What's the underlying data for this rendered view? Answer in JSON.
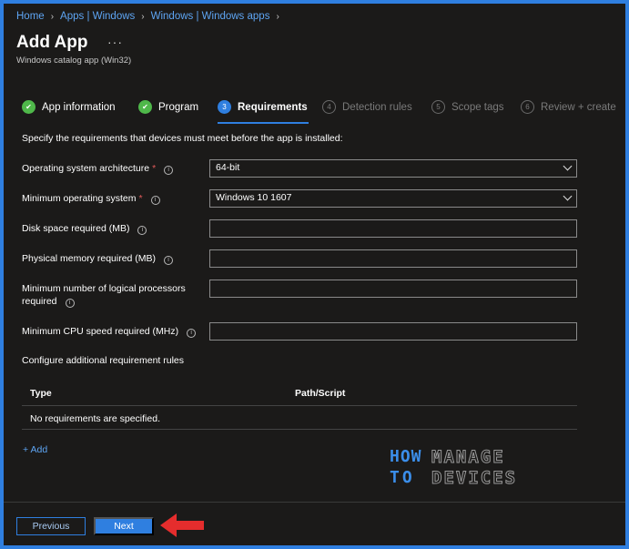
{
  "breadcrumb": [
    "Home",
    "Apps | Windows",
    "Windows | Windows apps"
  ],
  "header": {
    "title": "Add App",
    "more": "···",
    "subtitle": "Windows catalog app (Win32)"
  },
  "steps": [
    {
      "num": "",
      "label": "App information",
      "state": "done"
    },
    {
      "num": "",
      "label": "Program",
      "state": "done"
    },
    {
      "num": "3",
      "label": "Requirements",
      "state": "active"
    },
    {
      "num": "4",
      "label": "Detection rules",
      "state": "pending"
    },
    {
      "num": "5",
      "label": "Scope tags",
      "state": "pending"
    },
    {
      "num": "6",
      "label": "Review + create",
      "state": "pending"
    }
  ],
  "intro": "Specify the requirements that devices must meet before the app is installed:",
  "form": {
    "os_arch_label": "Operating system architecture",
    "os_arch_value": "64-bit",
    "min_os_label": "Minimum operating system",
    "min_os_value": "Windows 10 1607",
    "disk_label": "Disk space required (MB)",
    "disk_value": "",
    "memory_label": "Physical memory required (MB)",
    "memory_value": "",
    "processors_label": "Minimum number of logical processors required",
    "processors_value": "",
    "cpu_label": "Minimum CPU speed required (MHz)",
    "cpu_value": ""
  },
  "additional": {
    "label": "Configure additional requirement rules",
    "col_type": "Type",
    "col_path": "Path/Script",
    "empty": "No requirements are specified.",
    "add": "+ Add"
  },
  "logo": {
    "how": "HOW",
    "to": "TO",
    "manage": "MANAGE",
    "devices": "DEVICES"
  },
  "footer": {
    "previous": "Previous",
    "next": "Next"
  },
  "colors": {
    "accent": "#2f7fe0",
    "success": "#4fb84a",
    "required": "#e05a5a",
    "arrow": "#e52d2d"
  }
}
